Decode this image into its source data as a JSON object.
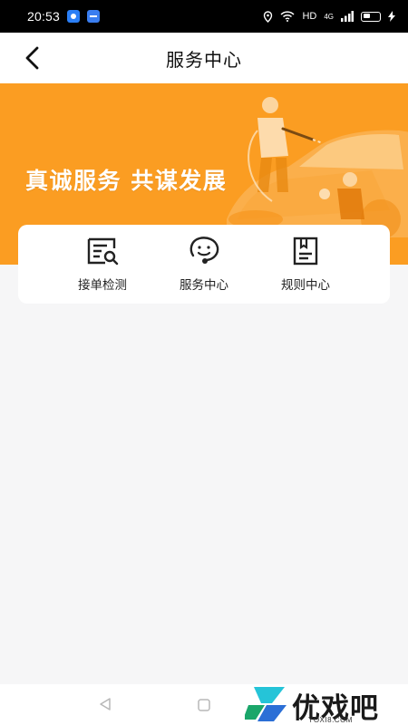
{
  "status_bar": {
    "time": "20:53",
    "network": "HD",
    "signal": "4G"
  },
  "header": {
    "title": "服务中心"
  },
  "banner": {
    "slogan": "真诚服务 共谋发展",
    "background_color": "#fb9d22"
  },
  "services": [
    {
      "label": "接单检测",
      "icon": "order-check-icon"
    },
    {
      "label": "服务中心",
      "icon": "customer-service-icon"
    },
    {
      "label": "规则中心",
      "icon": "rules-book-icon"
    }
  ],
  "watermark": {
    "text": "优戏吧",
    "sub": "YOXI8.COM"
  },
  "colors": {
    "accent": "#fb9d22",
    "page_background": "#f6f6f7",
    "card": "#ffffff"
  }
}
